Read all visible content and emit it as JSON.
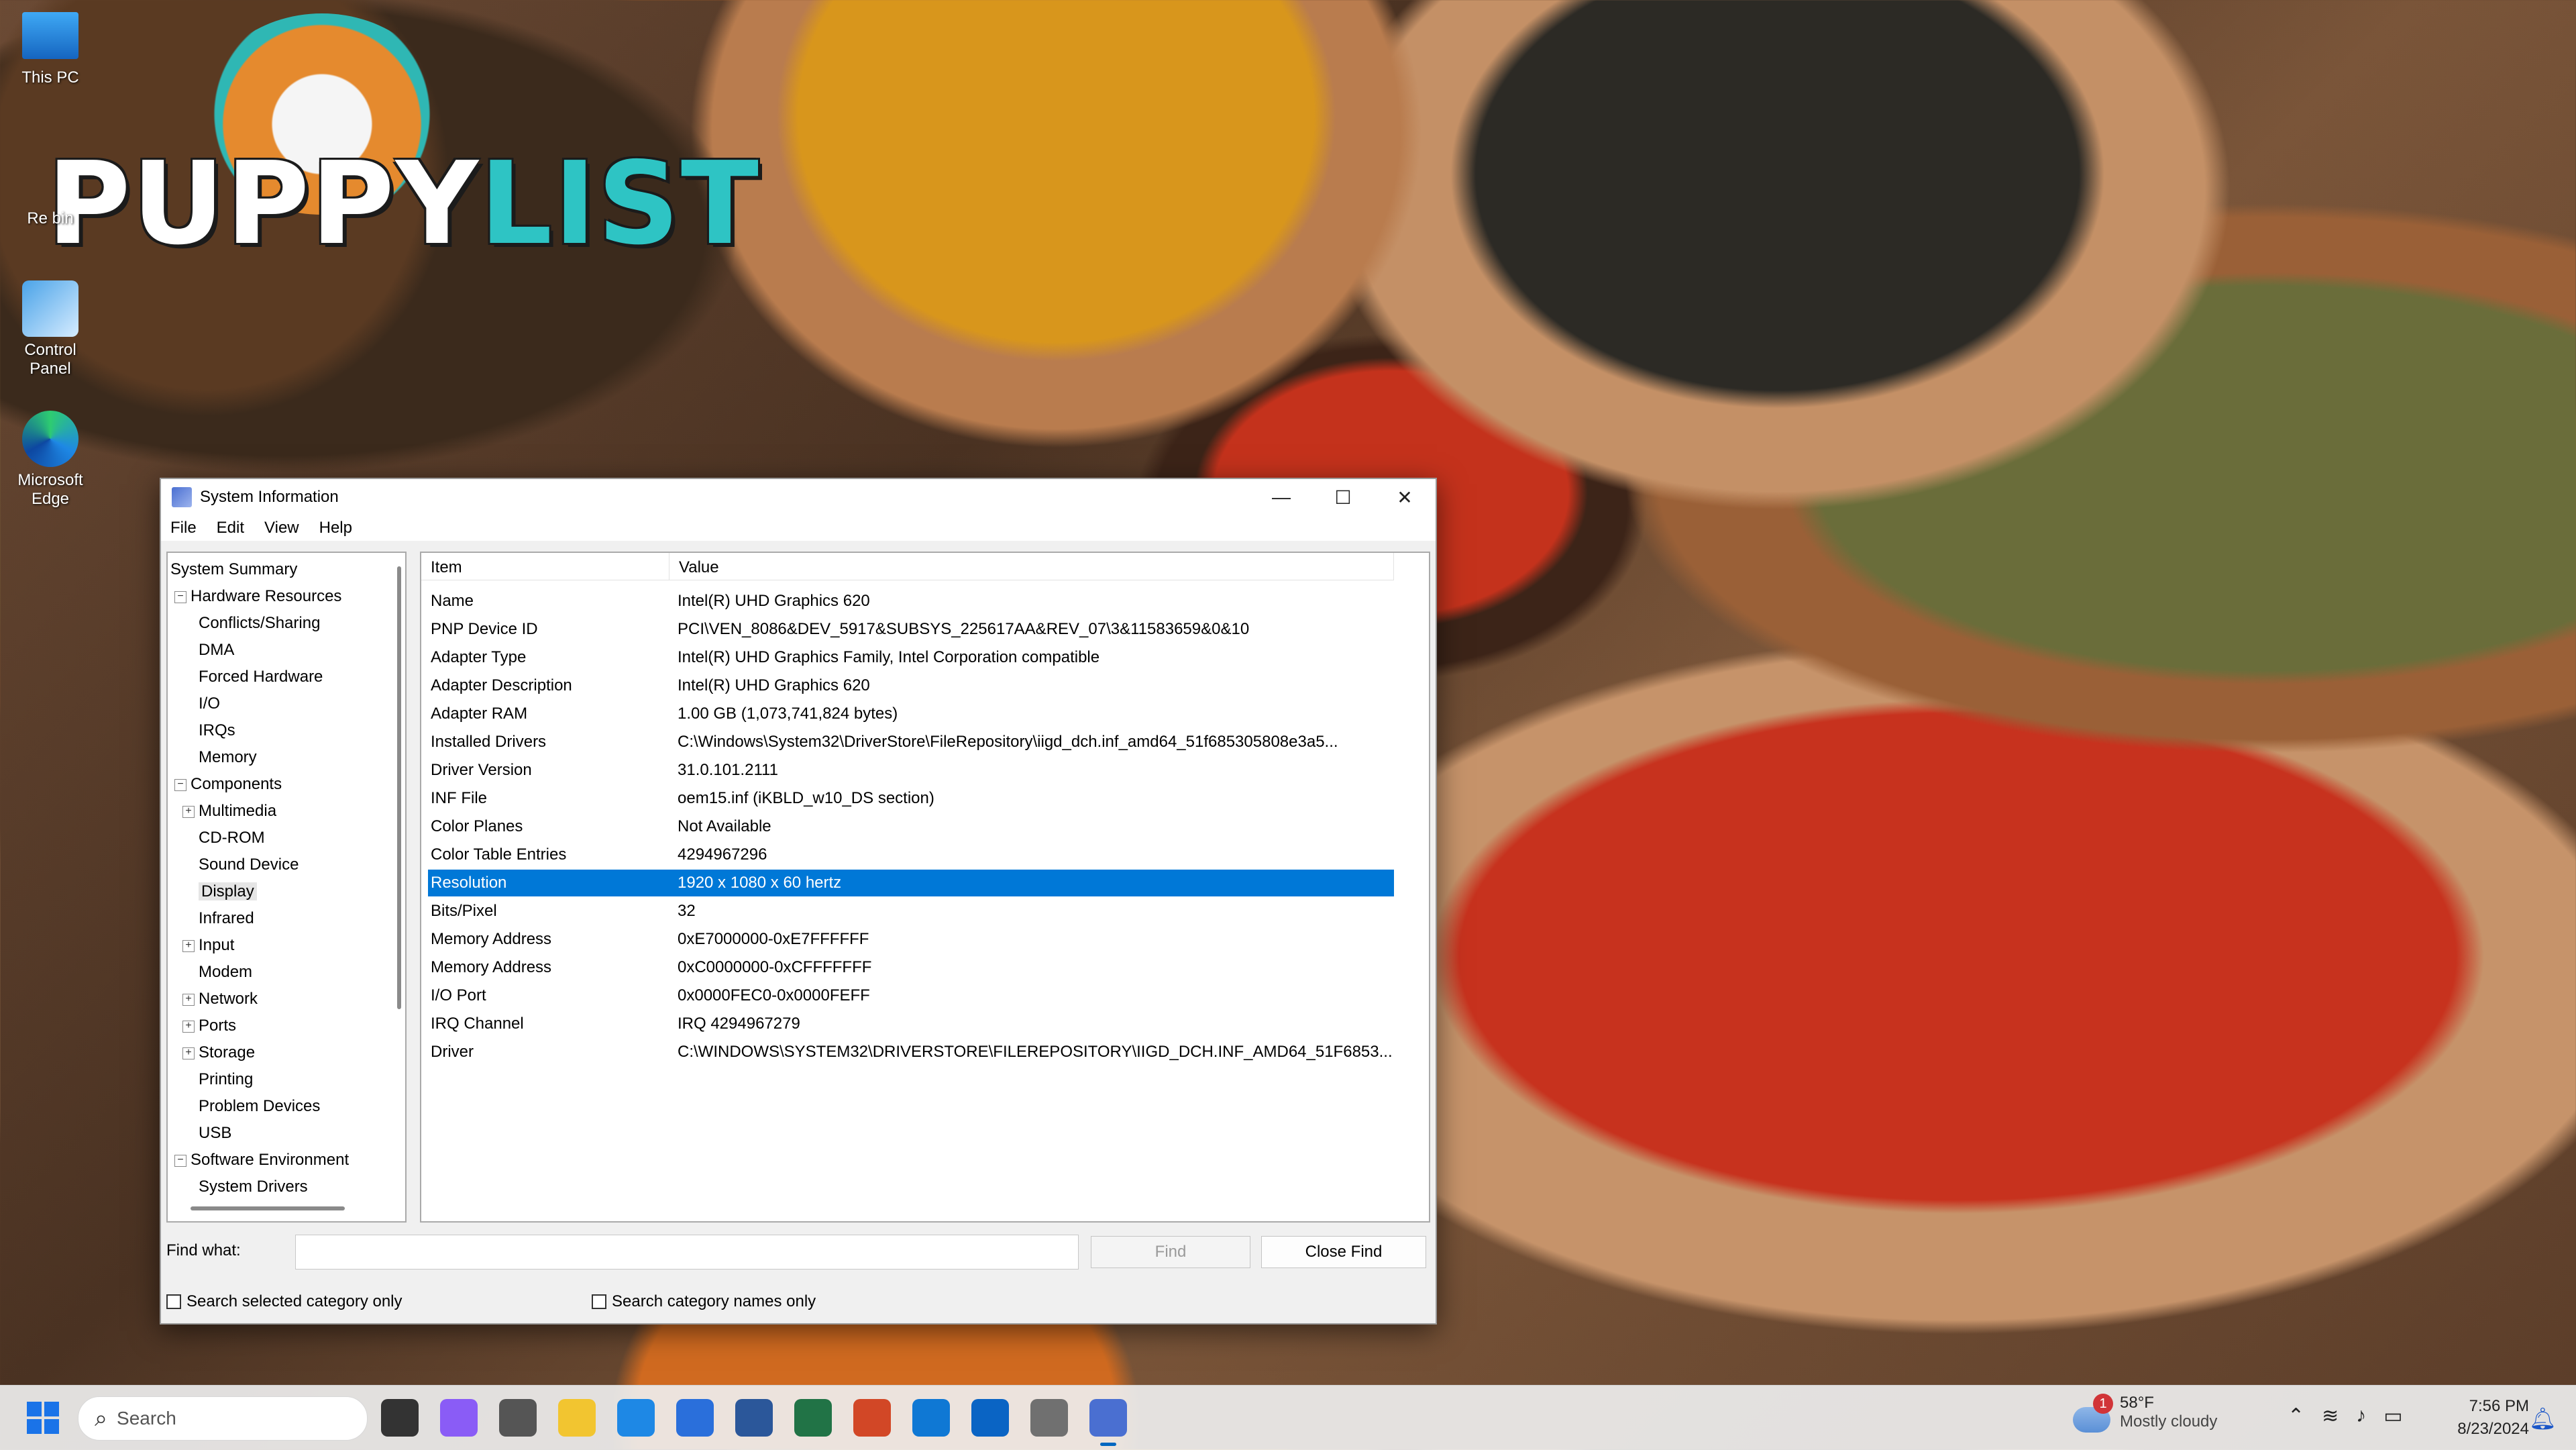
{
  "desktop": {
    "icons": [
      {
        "label": "This PC",
        "icon": "monitor-icon"
      },
      {
        "label": "Re    bin",
        "icon": "recycle-bin-icon"
      },
      {
        "label": "Control Panel",
        "icon": "control-panel-icon"
      },
      {
        "label": "Microsoft Edge",
        "icon": "edge-icon"
      }
    ],
    "watermark": {
      "text_a": "PUPPY",
      "text_b": "LIST"
    }
  },
  "window": {
    "title": "System Information",
    "controls": {
      "minimize": "—",
      "maximize": "☐",
      "close": "✕"
    },
    "menu": [
      "File",
      "Edit",
      "View",
      "Help"
    ],
    "tree": [
      {
        "label": "System Summary",
        "level": 0,
        "expander": ""
      },
      {
        "label": "Hardware Resources",
        "level": 1,
        "expander": "−"
      },
      {
        "label": "Conflicts/Sharing",
        "level": 2,
        "expander": ""
      },
      {
        "label": "DMA",
        "level": 2,
        "expander": ""
      },
      {
        "label": "Forced Hardware",
        "level": 2,
        "expander": ""
      },
      {
        "label": "I/O",
        "level": 2,
        "expander": ""
      },
      {
        "label": "IRQs",
        "level": 2,
        "expander": ""
      },
      {
        "label": "Memory",
        "level": 2,
        "expander": ""
      },
      {
        "label": "Components",
        "level": 1,
        "expander": "−"
      },
      {
        "label": "Multimedia",
        "level": 2,
        "expander": "+"
      },
      {
        "label": "CD-ROM",
        "level": 2,
        "expander": ""
      },
      {
        "label": "Sound Device",
        "level": 2,
        "expander": ""
      },
      {
        "label": "Display",
        "level": 2,
        "expander": "",
        "selected": true
      },
      {
        "label": "Infrared",
        "level": 2,
        "expander": ""
      },
      {
        "label": "Input",
        "level": 2,
        "expander": "+"
      },
      {
        "label": "Modem",
        "level": 2,
        "expander": ""
      },
      {
        "label": "Network",
        "level": 2,
        "expander": "+"
      },
      {
        "label": "Ports",
        "level": 2,
        "expander": "+"
      },
      {
        "label": "Storage",
        "level": 2,
        "expander": "+"
      },
      {
        "label": "Printing",
        "level": 2,
        "expander": ""
      },
      {
        "label": "Problem Devices",
        "level": 2,
        "expander": ""
      },
      {
        "label": "USB",
        "level": 2,
        "expander": ""
      },
      {
        "label": "Software Environment",
        "level": 1,
        "expander": "−"
      },
      {
        "label": "System Drivers",
        "level": 2,
        "expander": ""
      }
    ],
    "list": {
      "headers": [
        "Item",
        "Value"
      ],
      "rows": [
        [
          "Name",
          "Intel(R) UHD Graphics 620"
        ],
        [
          "PNP Device ID",
          "PCI\\VEN_8086&DEV_5917&SUBSYS_225617AA&REV_07\\3&11583659&0&10"
        ],
        [
          "Adapter Type",
          "Intel(R) UHD Graphics Family, Intel Corporation compatible"
        ],
        [
          "Adapter Description",
          "Intel(R) UHD Graphics 620"
        ],
        [
          "Adapter RAM",
          "1.00 GB (1,073,741,824 bytes)"
        ],
        [
          "Installed Drivers",
          "C:\\Windows\\System32\\DriverStore\\FileRepository\\iigd_dch.inf_amd64_51f685305808e3a5..."
        ],
        [
          "Driver Version",
          "31.0.101.2111"
        ],
        [
          "INF File",
          "oem15.inf (iKBLD_w10_DS section)"
        ],
        [
          "Color Planes",
          "Not Available"
        ],
        [
          "Color Table Entries",
          "4294967296"
        ],
        [
          "Resolution",
          "1920 x 1080 x 60 hertz"
        ],
        [
          "Bits/Pixel",
          "32"
        ],
        [
          "Memory Address",
          "0xE7000000-0xE7FFFFFF"
        ],
        [
          "Memory Address",
          "0xC0000000-0xCFFFFFFF"
        ],
        [
          "I/O Port",
          "0x0000FEC0-0x0000FEFF"
        ],
        [
          "IRQ Channel",
          "IRQ 4294967279"
        ],
        [
          "Driver",
          "C:\\WINDOWS\\SYSTEM32\\DRIVERSTORE\\FILEREPOSITORY\\IIGD_DCH.INF_AMD64_51F6853..."
        ]
      ],
      "selected_row": 10
    },
    "find": {
      "label": "Find what:",
      "value": "",
      "find_button": "Find",
      "close_button": "Close Find",
      "check1": "Search selected category only",
      "check2": "Search category names only"
    }
  },
  "taskbar": {
    "search_placeholder": "Search",
    "apps": [
      "task-view",
      "copilot",
      "camera",
      "file-explorer",
      "edge",
      "store",
      "word",
      "excel",
      "powerpoint",
      "outlook-new",
      "outlook",
      "settings",
      "system-information"
    ],
    "weather": {
      "badge": "1",
      "temp": "58°F",
      "condition": "Mostly cloudy"
    },
    "time": "7:56 PM",
    "date": "8/23/2024",
    "accent": "#0078d7"
  }
}
